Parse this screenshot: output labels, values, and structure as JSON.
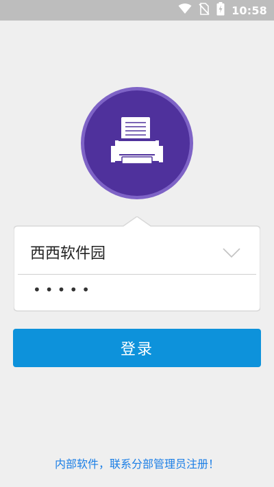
{
  "status_bar": {
    "time": "10:58",
    "icons": [
      "wifi-icon",
      "no-sim-icon",
      "battery-charging-icon"
    ]
  },
  "app": {
    "logo_icon": "printer-icon",
    "brand_colors": {
      "logo_outer": "#7e63c6",
      "logo_inner": "#4f319c",
      "button": "#0d92db",
      "footer_text": "#1a7ee6"
    }
  },
  "login_form": {
    "account_value": "西西软件园",
    "dropdown_icon": "chevron-down-icon",
    "password_masked": "•••••"
  },
  "login_button": {
    "label": "登录"
  },
  "footer": {
    "note": "内部软件，联系分部管理员注册！"
  }
}
